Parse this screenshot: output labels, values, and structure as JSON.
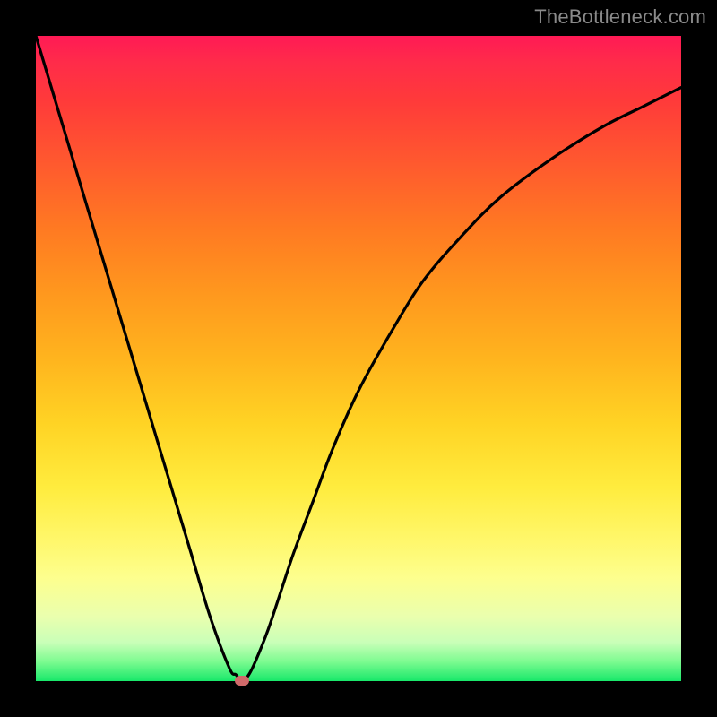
{
  "watermark": "TheBottleneck.com",
  "colors": {
    "frame": "#000000",
    "marker": "#d06a6a",
    "curve": "#000000",
    "gradient_top": "#ff1a55",
    "gradient_bottom": "#18e86a"
  },
  "chart_data": {
    "type": "line",
    "title": "",
    "xlabel": "",
    "ylabel": "",
    "xlim": [
      0,
      100
    ],
    "ylim": [
      0,
      100
    ],
    "grid": false,
    "legend": false,
    "series": [
      {
        "name": "bottleneck-curve",
        "x": [
          0,
          3,
          6,
          9,
          12,
          15,
          18,
          21,
          24,
          27,
          30,
          31,
          32,
          33,
          34,
          36,
          38,
          40,
          43,
          46,
          50,
          55,
          60,
          66,
          72,
          80,
          88,
          94,
          100
        ],
        "values": [
          100,
          90,
          80,
          70,
          60,
          50,
          40,
          30,
          20,
          10,
          2,
          1,
          0,
          1,
          3,
          8,
          14,
          20,
          28,
          36,
          45,
          54,
          62,
          69,
          75,
          81,
          86,
          89,
          92
        ]
      }
    ],
    "marker": {
      "x": 32,
      "y": 0
    },
    "gradient_stops": [
      {
        "pos": 0,
        "color": "#ff1a55"
      },
      {
        "pos": 10,
        "color": "#ff3a3a"
      },
      {
        "pos": 30,
        "color": "#ff7a22"
      },
      {
        "pos": 50,
        "color": "#ffb41e"
      },
      {
        "pos": 70,
        "color": "#ffec3e"
      },
      {
        "pos": 84,
        "color": "#fdff8e"
      },
      {
        "pos": 94,
        "color": "#c9ffb8"
      },
      {
        "pos": 100,
        "color": "#18e86a"
      }
    ]
  }
}
